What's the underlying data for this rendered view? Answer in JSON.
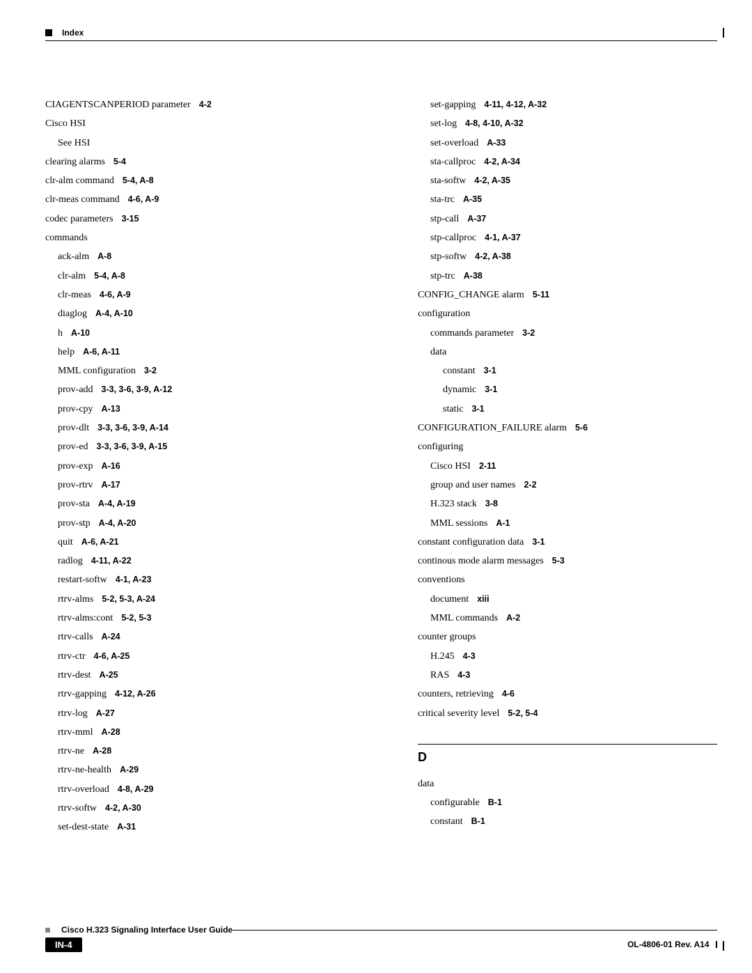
{
  "header": {
    "title": "Index"
  },
  "left": [
    {
      "t": "CIAGENTSCANPERIOD parameter",
      "r": "4-2",
      "i": 0
    },
    {
      "t": "Cisco HSI",
      "r": "",
      "i": 0
    },
    {
      "t": "See HSI",
      "r": "",
      "i": 1
    },
    {
      "t": "clearing alarms",
      "r": "5-4",
      "i": 0
    },
    {
      "t": "clr-alm command",
      "r": "5-4, A-8",
      "i": 0
    },
    {
      "t": "clr-meas command",
      "r": "4-6, A-9",
      "i": 0
    },
    {
      "t": "codec parameters",
      "r": "3-15",
      "i": 0
    },
    {
      "t": "commands",
      "r": "",
      "i": 0
    },
    {
      "t": "ack-alm",
      "r": "A-8",
      "i": 1
    },
    {
      "t": "clr-alm",
      "r": "5-4, A-8",
      "i": 1
    },
    {
      "t": "clr-meas",
      "r": "4-6, A-9",
      "i": 1
    },
    {
      "t": "diaglog",
      "r": "A-4, A-10",
      "i": 1
    },
    {
      "t": "h",
      "r": "A-10",
      "i": 1
    },
    {
      "t": "help",
      "r": "A-6, A-11",
      "i": 1
    },
    {
      "t": "MML configuration",
      "r": "3-2",
      "i": 1
    },
    {
      "t": "prov-add",
      "r": "3-3, 3-6, 3-9, A-12",
      "i": 1
    },
    {
      "t": "prov-cpy",
      "r": "A-13",
      "i": 1
    },
    {
      "t": "prov-dlt",
      "r": "3-3, 3-6, 3-9, A-14",
      "i": 1
    },
    {
      "t": "prov-ed",
      "r": "3-3, 3-6, 3-9, A-15",
      "i": 1
    },
    {
      "t": "prov-exp",
      "r": "A-16",
      "i": 1
    },
    {
      "t": "prov-rtrv",
      "r": "A-17",
      "i": 1
    },
    {
      "t": "prov-sta",
      "r": "A-4, A-19",
      "i": 1
    },
    {
      "t": "prov-stp",
      "r": "A-4, A-20",
      "i": 1
    },
    {
      "t": "quit",
      "r": "A-6, A-21",
      "i": 1
    },
    {
      "t": "radlog",
      "r": "4-11, A-22",
      "i": 1
    },
    {
      "t": "restart-softw",
      "r": "4-1, A-23",
      "i": 1
    },
    {
      "t": "rtrv-alms",
      "r": "5-2, 5-3, A-24",
      "i": 1
    },
    {
      "t": "rtrv-alms:cont",
      "r": "5-2, 5-3",
      "i": 1
    },
    {
      "t": "rtrv-calls",
      "r": "A-24",
      "i": 1
    },
    {
      "t": "rtrv-ctr",
      "r": "4-6, A-25",
      "i": 1
    },
    {
      "t": "rtrv-dest",
      "r": "A-25",
      "i": 1
    },
    {
      "t": "rtrv-gapping",
      "r": "4-12, A-26",
      "i": 1
    },
    {
      "t": "rtrv-log",
      "r": "A-27",
      "i": 1
    },
    {
      "t": "rtrv-mml",
      "r": "A-28",
      "i": 1
    },
    {
      "t": "rtrv-ne",
      "r": "A-28",
      "i": 1
    },
    {
      "t": "rtrv-ne-health",
      "r": "A-29",
      "i": 1
    },
    {
      "t": "rtrv-overload",
      "r": "4-8, A-29",
      "i": 1
    },
    {
      "t": "rtrv-softw",
      "r": "4-2, A-30",
      "i": 1
    },
    {
      "t": "set-dest-state",
      "r": "A-31",
      "i": 1
    }
  ],
  "right": [
    {
      "t": "set-gapping",
      "r": "4-11, 4-12, A-32",
      "i": 1
    },
    {
      "t": "set-log",
      "r": "4-8, 4-10, A-32",
      "i": 1
    },
    {
      "t": "set-overload",
      "r": "A-33",
      "i": 1
    },
    {
      "t": "sta-callproc",
      "r": "4-2, A-34",
      "i": 1
    },
    {
      "t": "sta-softw",
      "r": "4-2, A-35",
      "i": 1
    },
    {
      "t": "sta-trc",
      "r": "A-35",
      "i": 1
    },
    {
      "t": "stp-call",
      "r": "A-37",
      "i": 1
    },
    {
      "t": "stp-callproc",
      "r": "4-1, A-37",
      "i": 1
    },
    {
      "t": "stp-softw",
      "r": "4-2, A-38",
      "i": 1
    },
    {
      "t": "stp-trc",
      "r": "A-38",
      "i": 1
    },
    {
      "t": "CONFIG_CHANGE alarm",
      "r": "5-11",
      "i": 0
    },
    {
      "t": "configuration",
      "r": "",
      "i": 0
    },
    {
      "t": "commands parameter",
      "r": "3-2",
      "i": 1
    },
    {
      "t": "data",
      "r": "",
      "i": 1
    },
    {
      "t": "constant",
      "r": "3-1",
      "i": 2
    },
    {
      "t": "dynamic",
      "r": "3-1",
      "i": 2
    },
    {
      "t": "static",
      "r": "3-1",
      "i": 2
    },
    {
      "t": "CONFIGURATION_FAILURE alarm",
      "r": "5-6",
      "i": 0
    },
    {
      "t": "configuring",
      "r": "",
      "i": 0
    },
    {
      "t": "Cisco HSI",
      "r": "2-11",
      "i": 1
    },
    {
      "t": "group and user names",
      "r": "2-2",
      "i": 1
    },
    {
      "t": "H.323 stack",
      "r": "3-8",
      "i": 1
    },
    {
      "t": "MML sessions",
      "r": "A-1",
      "i": 1
    },
    {
      "t": "constant configuration data",
      "r": "3-1",
      "i": 0
    },
    {
      "t": "continous mode alarm messages",
      "r": "5-3",
      "i": 0
    },
    {
      "t": "conventions",
      "r": "",
      "i": 0
    },
    {
      "t": "document",
      "r": "xiii",
      "i": 1
    },
    {
      "t": "MML commands",
      "r": "A-2",
      "i": 1
    },
    {
      "t": "counter groups",
      "r": "",
      "i": 0
    },
    {
      "t": "H.245",
      "r": "4-3",
      "i": 1
    },
    {
      "t": "RAS",
      "r": "4-3",
      "i": 1
    },
    {
      "t": "counters, retrieving",
      "r": "4-6",
      "i": 0
    },
    {
      "t": "critical severity level",
      "r": "5-2, 5-4",
      "i": 0
    }
  ],
  "section_d": {
    "letter": "D",
    "items": [
      {
        "t": "data",
        "r": "",
        "i": 0
      },
      {
        "t": "configurable",
        "r": "B-1",
        "i": 1
      },
      {
        "t": "constant",
        "r": "B-1",
        "i": 1
      }
    ]
  },
  "footer": {
    "title": "Cisco H.323 Signaling Interface User Guide",
    "page": "IN-4",
    "docid": "OL-4806-01 Rev. A14"
  }
}
